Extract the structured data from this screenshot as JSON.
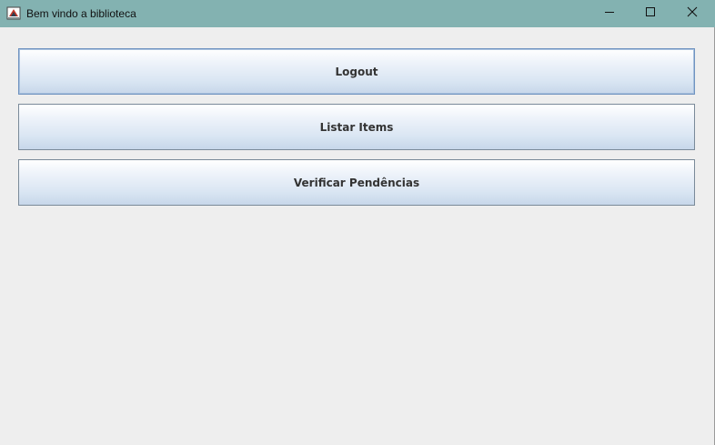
{
  "window": {
    "title": "Bem vindo a biblioteca",
    "icon": "java-app-icon",
    "controls": [
      "minimize-icon",
      "maximize-icon",
      "close-icon"
    ]
  },
  "buttons": [
    {
      "label": "Logout",
      "focused": true
    },
    {
      "label": "Listar Items",
      "focused": false
    },
    {
      "label": "Verificar Pendências",
      "focused": false
    }
  ],
  "colors": {
    "titlebar": "#83b2b1",
    "background": "#eeeeee",
    "button_border": "#7a8a99",
    "button_text": "#333333"
  }
}
